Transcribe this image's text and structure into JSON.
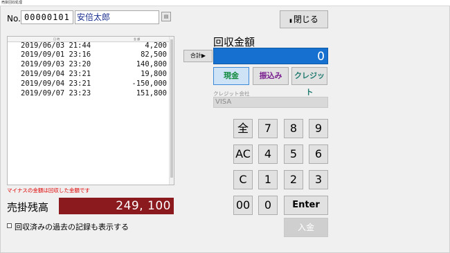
{
  "window": {
    "title": "売掛回収処理"
  },
  "customer": {
    "no_label": "No.",
    "number": "00000101",
    "name": "安倍太郎",
    "lookup_icon": "lookup-icon"
  },
  "close_button": {
    "icon": "close-door-icon",
    "label": "閉じる"
  },
  "list": {
    "headers": {
      "date": "日 時",
      "amount": "金 額"
    },
    "rows": [
      {
        "datetime": "2019/06/03 21:44",
        "amount": "4,200"
      },
      {
        "datetime": "2019/09/01 23:16",
        "amount": "82,500"
      },
      {
        "datetime": "2019/09/03 23:20",
        "amount": "140,800"
      },
      {
        "datetime": "2019/09/04 23:21",
        "amount": "19,800"
      },
      {
        "datetime": "2019/09/04 23:21",
        "amount": "-150,000"
      },
      {
        "datetime": "2019/09/07 23:23",
        "amount": "151,800"
      }
    ]
  },
  "negative_note": "マイナスの金額は回収した金額です",
  "balance": {
    "label": "売掛残高",
    "value": "249, 100",
    "bg_color": "#8b1a1f"
  },
  "show_past_checkbox": {
    "label": "回収済みの過去の記録も表示する",
    "checked": false
  },
  "collect": {
    "title": "回収金額",
    "total_button": "合計▶",
    "value": "0",
    "bg_color": "#1670d0"
  },
  "payment_methods": {
    "cash": "現金",
    "transfer": "振込み",
    "credit": "クレジット",
    "selected": "cash"
  },
  "credit_company": {
    "label": "クレジット会社",
    "value": "VISA"
  },
  "keypad": {
    "rows": [
      [
        "全",
        "7",
        "8",
        "9"
      ],
      [
        "AC",
        "4",
        "5",
        "6"
      ],
      [
        "C",
        "1",
        "2",
        "3"
      ],
      [
        "00",
        "0",
        "Enter"
      ]
    ]
  },
  "deposit_button": "入金"
}
